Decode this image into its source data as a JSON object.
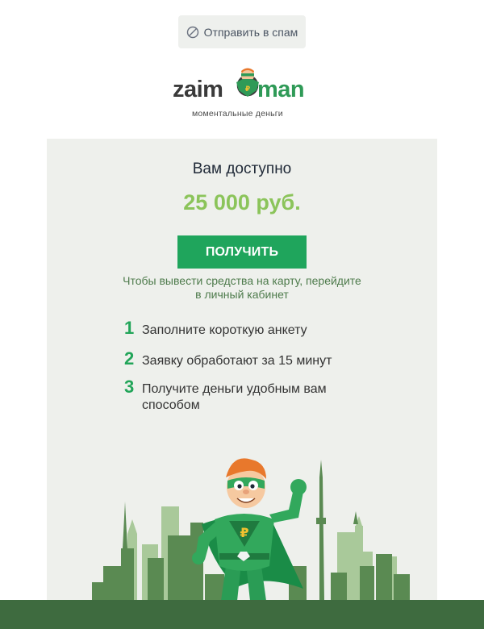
{
  "spam_button": {
    "label": "Отправить в спам",
    "icon": "no-entry-icon"
  },
  "logo": {
    "word_left": "zaim",
    "word_right": "man",
    "tagline": "моментальные деньги"
  },
  "card": {
    "title": "Вам доступно",
    "amount": "25 000 руб.",
    "cta_label": "ПОЛУЧИТЬ",
    "hint_line1": "Чтобы вывести средства на карту, перейдите",
    "hint_line2": "в личный кабинет"
  },
  "steps": [
    {
      "num": "1",
      "text": "Заполните короткую анкету"
    },
    {
      "num": "2",
      "text": "Заявку обработают за 15 минут"
    },
    {
      "num": "3",
      "text": "Получите деньги удобным вам способом"
    }
  ],
  "colors": {
    "accent": "#1fa55c",
    "amount": "#8bc45a",
    "card_bg": "#eef0ec",
    "ground": "#3e6b3f"
  }
}
